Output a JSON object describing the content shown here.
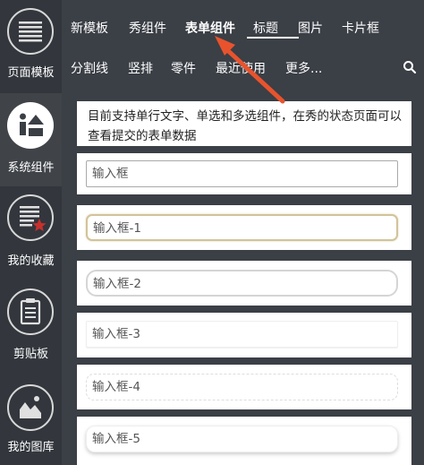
{
  "sidebar": {
    "items": [
      {
        "label": "页面模板",
        "icon": "page-list-icon"
      },
      {
        "label": "系统组件",
        "icon": "component-shapes-icon"
      },
      {
        "label": "我的收藏",
        "icon": "favorite-list-icon"
      },
      {
        "label": "剪贴板",
        "icon": "clipboard-icon"
      },
      {
        "label": "我的图库",
        "icon": "gallery-image-icon"
      }
    ],
    "active_index": 1
  },
  "nav": {
    "row1": [
      "新模板",
      "秀组件",
      "表单组件",
      "标题",
      "图片",
      "卡片框"
    ],
    "row2": [
      "分割线",
      "竖排",
      "零件",
      "最近使用",
      "更多..."
    ],
    "active": "表单组件",
    "search_icon": "search-icon"
  },
  "content": {
    "description": "目前支持单行文字、单选和多选组件，在秀的状态页面可以查看提交的表单数据",
    "fields": [
      "输入框",
      "输入框-1",
      "输入框-2",
      "输入框-3",
      "输入框-4",
      "输入框-5"
    ]
  },
  "colors": {
    "sidebar_bg": "#33373d",
    "sidebar_active_bg": "#404449",
    "nav_bg": "#3b3f46",
    "arrow": "#e8532d"
  }
}
